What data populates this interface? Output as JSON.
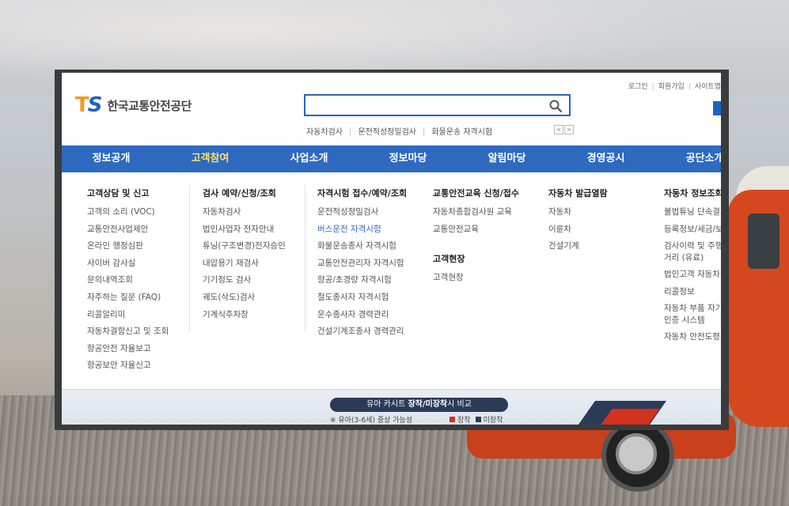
{
  "utility_links": [
    "로그인",
    "회원가입",
    "사이트맵"
  ],
  "logo": {
    "mark_t": "T",
    "mark_s": "S",
    "name": "한국교통안전공단"
  },
  "search": {
    "value": "",
    "placeholder": ""
  },
  "quick_links": [
    "자동차검사",
    "운전적성정밀검사",
    "화물운송 자격시험"
  ],
  "quick_nav": {
    "prev": "<",
    "next": ">"
  },
  "gnb": [
    "정보공개",
    "고객참여",
    "사업소개",
    "정보마당",
    "알림마당",
    "경영공시",
    "공단소개"
  ],
  "gnb_active_index": 1,
  "menu": {
    "col1": {
      "title": "고객상담 및 신고",
      "items": [
        "고객의 소리 (VOC)",
        "교통안전사업제안",
        "온라인 행정심판",
        "사이버 감사실",
        "문의내역조회",
        "자주하는 질문 (FAQ)",
        "리콜알리미",
        "자동차결함신고 및 조회",
        "항공안전 자율보고",
        "항공보안 자율신고"
      ]
    },
    "col2": {
      "title": "검사 예약/신청/조회",
      "items": [
        "자동차검사",
        "법인사업자 전자안내",
        "튜닝(구조변경)전자승인",
        "내압용기 재검사",
        "기기정도 검사",
        "궤도(삭도)검사",
        "기계식주차장"
      ]
    },
    "col3": {
      "title": "자격시험 접수/예약/조회",
      "items": [
        "운전적성정밀검사",
        "버스운전 자격시험",
        "화물운송종사 자격시험",
        "교통안전관리자 자격시험",
        "항공/초경량 자격시험",
        "철도종사자 자격시험",
        "운수종사자 경력관리",
        "건설기계조종사 경력관리"
      ],
      "highlight_index": 1
    },
    "col4": {
      "title": "교통안전교육 신청/접수",
      "items": [
        "자동차종합검사원 교육",
        "교통안전교육"
      ],
      "sub_title": "고객현장",
      "sub_items": [
        "고객현장"
      ]
    },
    "col5": {
      "title": "자동차 발급열람",
      "items": [
        "자동차",
        "이륜차",
        "건설기계"
      ]
    },
    "col6": {
      "title": "자동차 정보조회",
      "items": [
        "불법튜닝 단속결과",
        "등록정보/세금/보험",
        "검사이력 및 주행거리 (유료)",
        "법인고객 자동차정보",
        "리콜정보",
        "자동차 부품 자기인증 시스템",
        "자동차 안전도평가"
      ]
    }
  },
  "banner": {
    "pill_prefix": "유아 카시트 ",
    "pill_bold": "장착/미장착",
    "pill_suffix": "시 비교",
    "note": "※ 유아(3-6세) 중상 가능성",
    "legend_installed": "장착",
    "legend_not_installed": "미장착"
  },
  "colors": {
    "primary": "#2e6ac0",
    "accent_orange": "#f39a1e",
    "gnb_active": "#ffe36a",
    "banner_navy": "#2b3b57",
    "banner_red": "#d3321f"
  }
}
